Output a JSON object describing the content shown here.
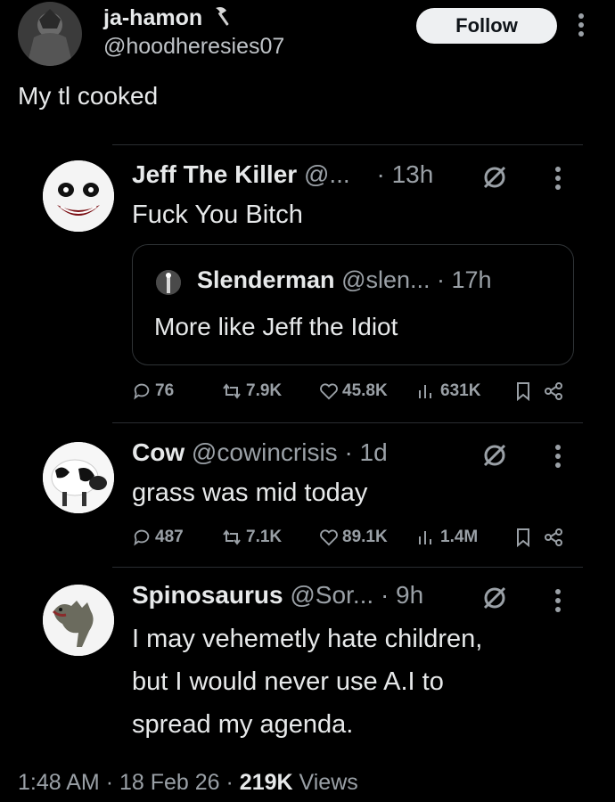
{
  "author": {
    "name": "ja-hamon",
    "handle": "@hoodheresies07",
    "follow_label": "Follow"
  },
  "post": {
    "text": "My tl cooked"
  },
  "tweets": [
    {
      "name": "Jeff The Killer",
      "handle": "@...",
      "time": "· 13h",
      "text_lines": [
        "Fuck You Bitch"
      ],
      "quote": {
        "name": "Slenderman",
        "handle": "@slen... · 17h",
        "text": "More like  Jeff the Idiot"
      },
      "stats": {
        "replies": "76",
        "reposts": "7.9K",
        "likes": "45.8K",
        "views": "631K"
      }
    },
    {
      "name": "Cow",
      "handle": "@cowincrisis",
      "time": "· 1d",
      "text_lines": [
        "grass was mid today"
      ],
      "stats": {
        "replies": "487",
        "reposts": "7.1K",
        "likes": "89.1K",
        "views": "1.4M"
      }
    },
    {
      "name": "Spinosaurus",
      "handle": "@Sor...",
      "time": "· 9h",
      "text_lines": [
        "I may vehemetly hate children,",
        "but I would never use A.I to",
        "spread my agenda."
      ]
    }
  ],
  "footer": {
    "time": "1:48 AM",
    "sep1": "·",
    "date": "18 Feb 26",
    "sep2": "·",
    "views_count": "219K",
    "views_label": "Views"
  },
  "colors": {
    "background": "#000000",
    "text": "#e7e9ea",
    "muted": "#9aa0a6",
    "follow_bg": "#eef0f2"
  },
  "icons": [
    "axe-icon",
    "more-icon",
    "no-view-icon",
    "reply-icon",
    "repost-icon",
    "like-icon",
    "views-icon",
    "bookmark-icon",
    "share-icon"
  ]
}
